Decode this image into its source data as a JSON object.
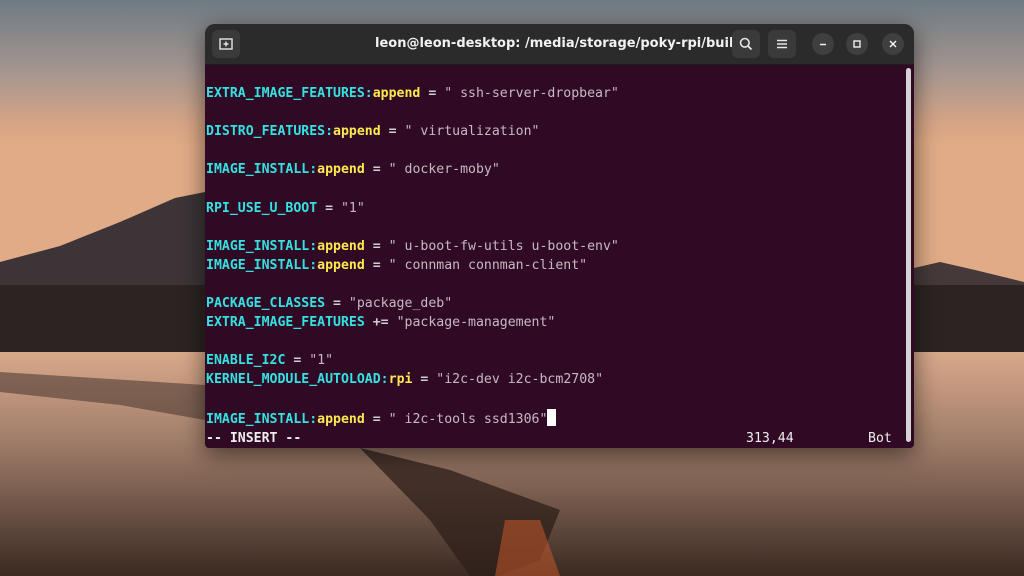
{
  "window": {
    "title": "leon@leon-desktop: /media/storage/poky-rpi/build"
  },
  "icons": {
    "new_tab": "new-tab-icon",
    "search": "search-icon",
    "menu": "hamburger-menu-icon",
    "minimize": "minimize-icon",
    "maximize": "maximize-icon",
    "close": "close-icon"
  },
  "editor": {
    "lines": [
      {
        "key": "EXTRA_IMAGE_FEATURES",
        "sep": ":",
        "op": "append",
        "rest": " = ",
        "value": "\" ssh-server-dropbear\""
      },
      null,
      {
        "key": "DISTRO_FEATURES",
        "sep": ":",
        "op": "append",
        "rest": " = ",
        "value": "\" virtualization\""
      },
      null,
      {
        "key": "IMAGE_INSTALL",
        "sep": ":",
        "op": "append",
        "rest": " = ",
        "value": "\" docker-moby\""
      },
      null,
      {
        "key": "RPI_USE_U_BOOT",
        "sep": "",
        "op": "",
        "rest": " = ",
        "value": "\"1\""
      },
      null,
      {
        "key": "IMAGE_INSTALL",
        "sep": ":",
        "op": "append",
        "rest": " = ",
        "value": "\" u-boot-fw-utils u-boot-env\""
      },
      {
        "key": "IMAGE_INSTALL",
        "sep": ":",
        "op": "append",
        "rest": " = ",
        "value": "\" connman connman-client\""
      },
      null,
      {
        "key": "PACKAGE_CLASSES",
        "sep": "",
        "op": "",
        "rest": " = ",
        "value": "\"package_deb\""
      },
      {
        "key": "EXTRA_IMAGE_FEATURES",
        "sep": "",
        "op": "",
        "rest": " += ",
        "value": "\"package-management\""
      },
      null,
      {
        "key": "ENABLE_I2C",
        "sep": "",
        "op": "",
        "rest": " = ",
        "value": "\"1\""
      },
      {
        "key": "KERNEL_MODULE_AUTOLOAD",
        "sep": ":",
        "op": "rpi",
        "rest": " = ",
        "value": "\"i2c-dev i2c-bcm2708\""
      },
      null,
      {
        "key": "IMAGE_INSTALL",
        "sep": ":",
        "op": "append",
        "rest": " = ",
        "value": "\" i2c-tools ssd1306\""
      }
    ]
  },
  "status": {
    "mode": "-- INSERT --",
    "position": "313,44",
    "scroll": "Bot"
  },
  "colors": {
    "terminal_bg": "#300a24",
    "keyword": "#34e2e2",
    "operator": "#fce94f",
    "string": "#c6b8c3"
  }
}
